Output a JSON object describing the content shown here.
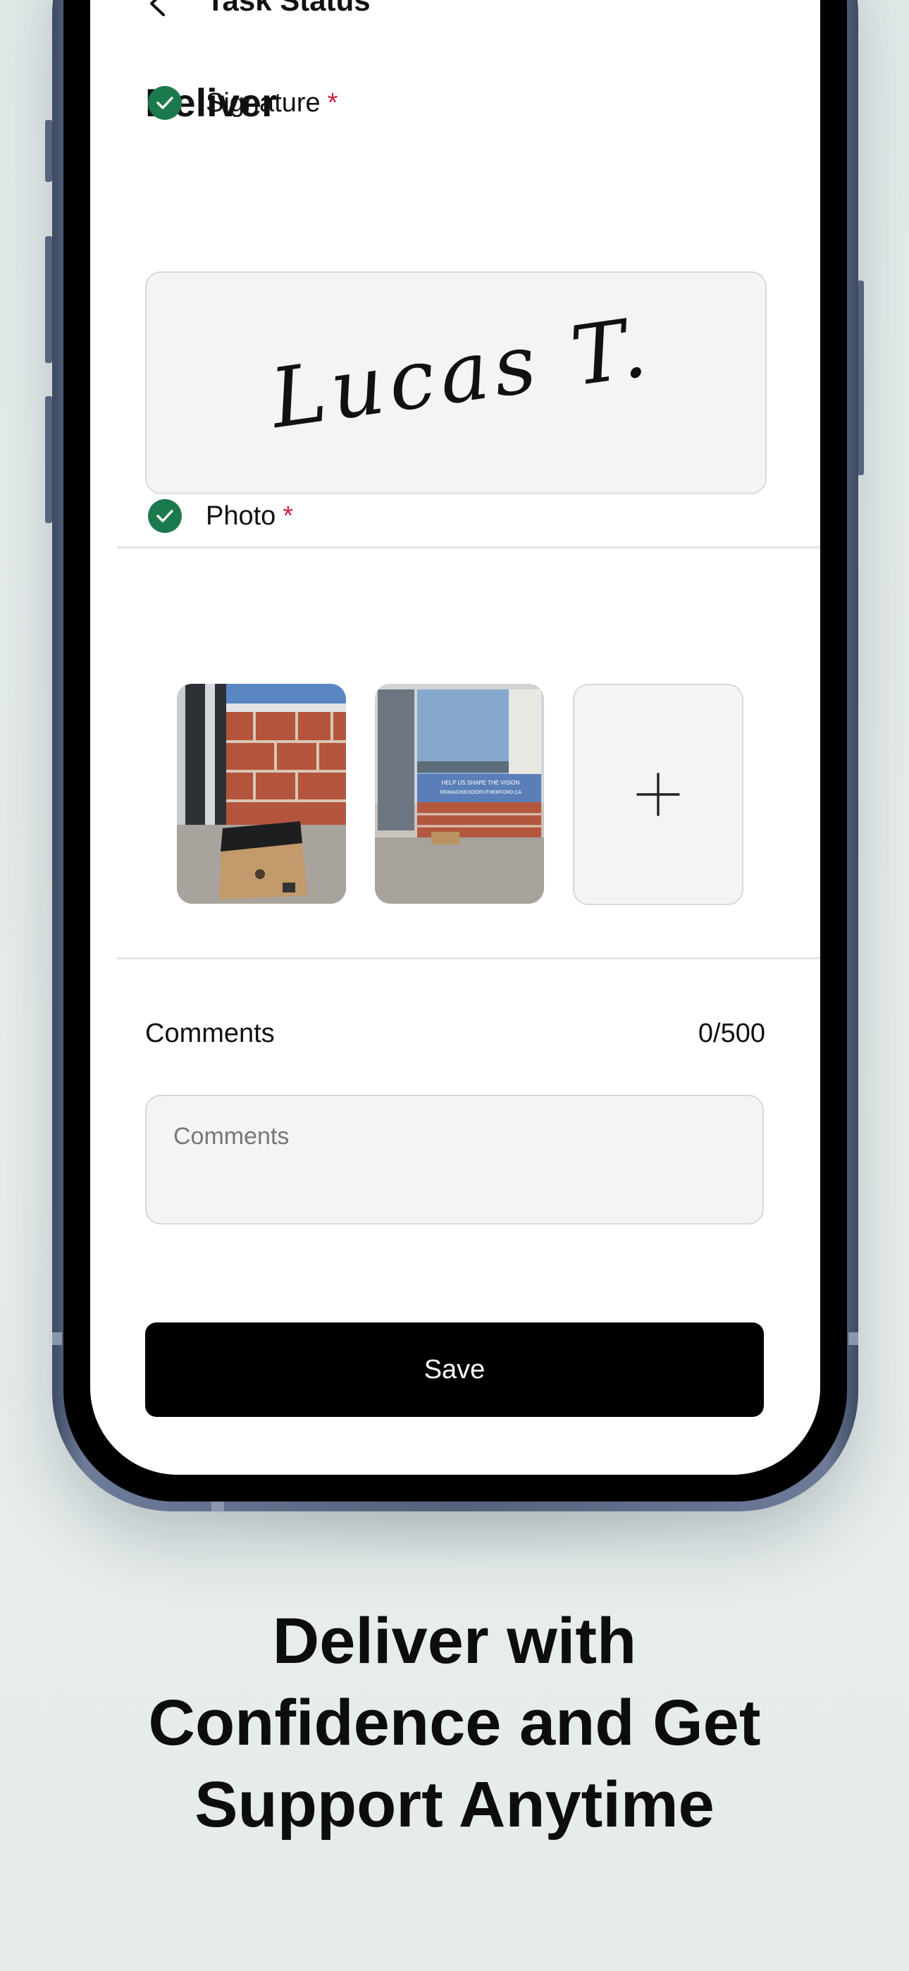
{
  "header": {
    "title": "Task Status"
  },
  "section": {
    "title": "Deliver"
  },
  "signature": {
    "label": "Signature",
    "required_mark": "*",
    "value": "Lucas T."
  },
  "photo": {
    "label": "Photo",
    "required_mark": "*",
    "count": 2,
    "images": [
      "package-at-door",
      "storefront-window"
    ],
    "window_text": [
      "HELP US SHAPE THE VISION",
      "REIMAGINEDOORUTHERFORD.CA"
    ]
  },
  "comments": {
    "label": "Comments",
    "count": "0/500",
    "placeholder": "Comments",
    "value": ""
  },
  "save": {
    "label": "Save"
  },
  "tagline": {
    "lines": [
      "Deliver with",
      "Confidence and Get",
      "Support Anytime"
    ]
  },
  "colors": {
    "success": "#1b7a4d",
    "required": "#d1233f",
    "button_bg": "#000000",
    "background": "#e6ecec",
    "phone_frame": "#54627e"
  }
}
